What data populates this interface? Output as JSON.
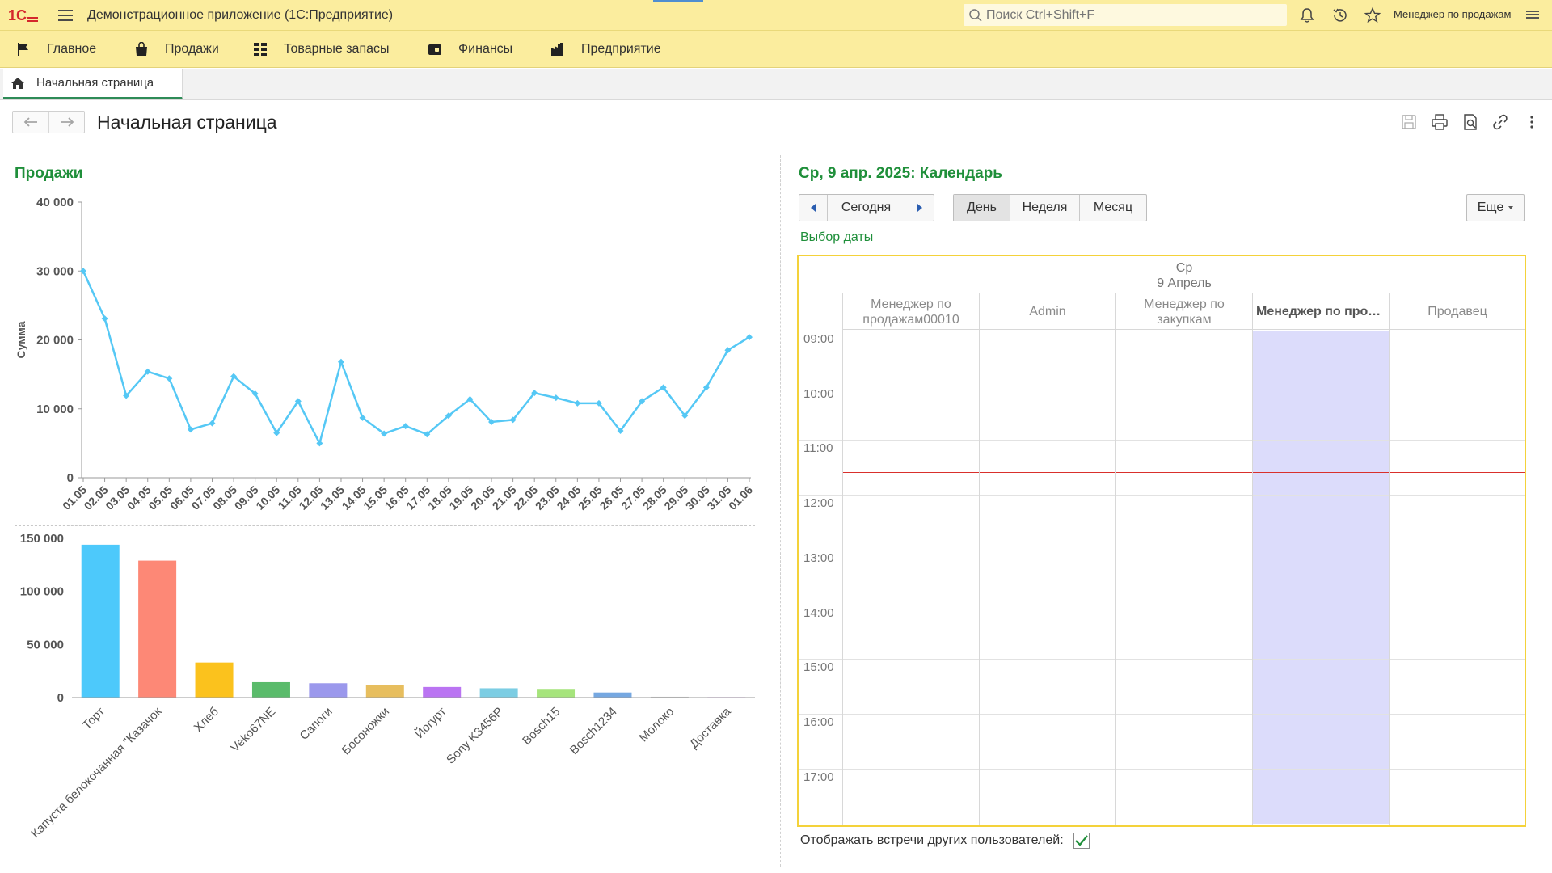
{
  "app": {
    "title": "Демонстрационное приложение  (1С:Предприятие)",
    "search_placeholder": "Поиск Ctrl+Shift+F",
    "user": "Менеджер по продажам"
  },
  "sections": [
    {
      "label": "Главное",
      "icon": "flag-icon"
    },
    {
      "label": "Продажи",
      "icon": "shopping-bag-icon"
    },
    {
      "label": "Товарные запасы",
      "icon": "grid-icon"
    },
    {
      "label": "Финансы",
      "icon": "wallet-icon"
    },
    {
      "label": "Предприятие",
      "icon": "factory-icon"
    }
  ],
  "tabs": [
    {
      "label": "Начальная страница",
      "icon": "home-icon",
      "active": true
    }
  ],
  "form": {
    "title": "Начальная страница"
  },
  "sales": {
    "title": "Продажи"
  },
  "chart_data": [
    {
      "type": "line",
      "title": "",
      "xlabel": "",
      "ylabel": "Сумма",
      "ylim": [
        0,
        40000
      ],
      "yticks": [
        "0",
        "10 000",
        "20 000",
        "30 000",
        "40 000"
      ],
      "color": "#55c8f5",
      "x": [
        "01.05",
        "02.05",
        "03.05",
        "04.05",
        "05.05",
        "06.05",
        "07.05",
        "08.05",
        "09.05",
        "10.05",
        "11.05",
        "12.05",
        "13.05",
        "14.05",
        "15.05",
        "16.05",
        "17.05",
        "18.05",
        "19.05",
        "20.05",
        "21.05",
        "22.05",
        "23.05",
        "24.05",
        "25.05",
        "26.05",
        "27.05",
        "28.05",
        "29.05",
        "30.05",
        "31.05",
        "01.06"
      ],
      "series": [
        {
          "values": [
            30000,
            23100,
            11900,
            15400,
            14400,
            7000,
            7900,
            14700,
            12200,
            6500,
            11100,
            5000,
            16800,
            8700,
            6400,
            7500,
            6300,
            9000,
            11400,
            8100,
            8400,
            12300,
            11600,
            10800,
            10800,
            6800,
            11100,
            13100,
            9000,
            13100,
            18500,
            20400
          ]
        }
      ]
    },
    {
      "type": "bar",
      "title": "",
      "xlabel": "",
      "ylabel": "",
      "ylim": [
        0,
        150000
      ],
      "yticks": [
        "0",
        "50 000",
        "100 000",
        "150 000"
      ],
      "categories": [
        "Торт",
        "Капуста белокочанная \"Казачок",
        "Хлеб",
        "Veko67NE",
        "Сапоги",
        "Босоножки",
        "Йогурт",
        "Sony K3456P",
        "Bosch15",
        "Bosch1234",
        "Молоко",
        "Доставка"
      ],
      "values": [
        144000,
        129000,
        33000,
        14500,
        13500,
        12000,
        10000,
        8800,
        8200,
        4800,
        800,
        500
      ],
      "colors": [
        "#4dc9fb",
        "#fd8876",
        "#fbc21d",
        "#5abb6b",
        "#9b98ec",
        "#e7be5e",
        "#ba74f2",
        "#7ccde3",
        "#a6e47c",
        "#76a8e1",
        "#c6c6c6",
        "#d6a8e8"
      ]
    }
  ],
  "calendar": {
    "title": "Ср, 9 апр. 2025: Календарь",
    "today_label": "Сегодня",
    "view_day": "День",
    "view_week": "Неделя",
    "view_month": "Месяц",
    "more_label": "Еще",
    "date_pick_link": "Выбор даты",
    "day_name": "Ср",
    "day_date": "9 Апрель",
    "columns": [
      "Менеджер по продажам00010",
      "Admin",
      "Менеджер по закупкам",
      "Менеджер по продажам",
      "Продавец"
    ],
    "current_column_index": 3,
    "hours": [
      "09:00",
      "10:00",
      "11:00",
      "12:00",
      "13:00",
      "14:00",
      "15:00",
      "16:00",
      "17:00"
    ],
    "current_time_line": "11:38",
    "show_others_label": "Отображать встречи других пользователей:",
    "show_others_checked": true
  },
  "colors": {
    "accent_yellow": "#fbed9e",
    "section_title_green": "#1f8f3a",
    "calendar_border": "#f4d23a",
    "current_column_bg": "#dcdcfb",
    "now_line": "#d9302c"
  }
}
